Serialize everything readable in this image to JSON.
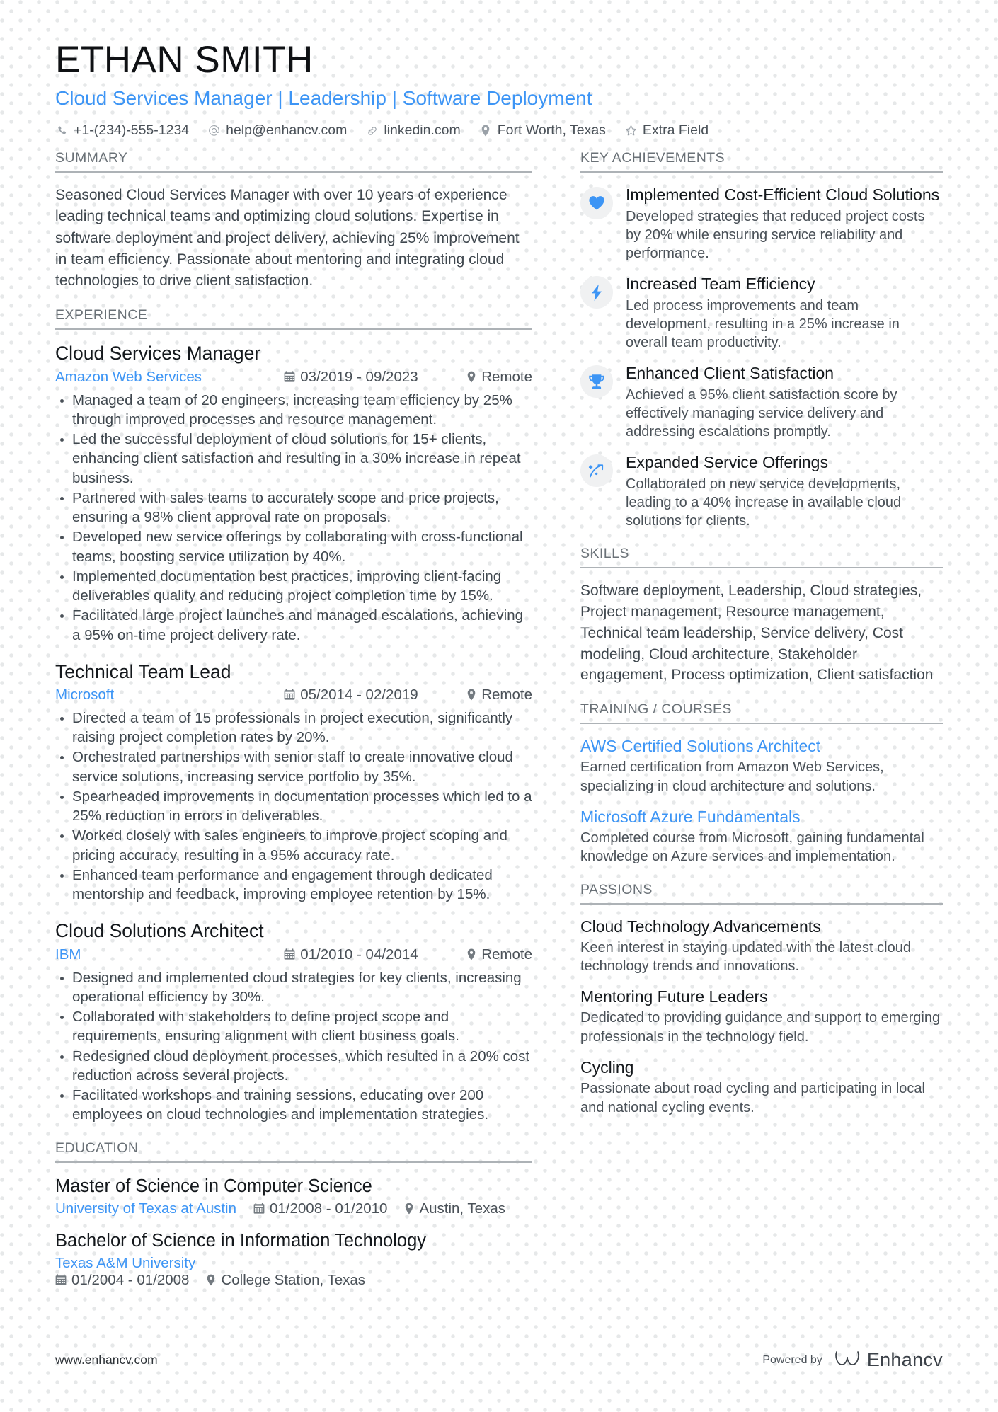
{
  "header": {
    "name": "ETHAN SMITH",
    "headline": "Cloud Services Manager | Leadership | Software Deployment",
    "contacts": [
      {
        "icon": "phone-icon",
        "text": "+1-(234)-555-1234"
      },
      {
        "icon": "at-sign-icon",
        "text": "help@enhancv.com"
      },
      {
        "icon": "link-icon",
        "text": "linkedin.com"
      },
      {
        "icon": "map-pin-icon",
        "text": "Fort Worth, Texas"
      },
      {
        "icon": "star-icon",
        "text": "Extra Field"
      }
    ]
  },
  "colors": {
    "accent_blue": "#3d95f5",
    "heading_gray": "#6a7177",
    "body_text": "#3f474e",
    "rule_gray": "#adb2b6",
    "icon_bubble": "#f0f1f2",
    "dot_pattern": "#e6e8e9"
  },
  "left": {
    "summary": {
      "title": "SUMMARY",
      "text": "Seasoned Cloud Services Manager with over 10 years of experience leading technical teams and optimizing cloud solutions. Expertise in software deployment and project delivery, achieving 25% improvement in team efficiency. Passionate about mentoring and integrating cloud technologies to drive client satisfaction."
    },
    "experience": {
      "title": "EXPERIENCE",
      "jobs": [
        {
          "title": "Cloud Services Manager",
          "company": "Amazon Web Services",
          "dates": "03/2019 - 09/2023",
          "location": "Remote",
          "bullets": [
            "Managed a team of 20 engineers, increasing team efficiency by 25% through improved processes and resource management.",
            "Led the successful deployment of cloud solutions for 15+ clients, enhancing client satisfaction and resulting in a 30% increase in repeat business.",
            "Partnered with sales teams to accurately scope and price projects, ensuring a 98% client approval rate on proposals.",
            "Developed new service offerings by collaborating with cross-functional teams, boosting service utilization by 40%.",
            "Implemented documentation best practices, improving client-facing deliverables quality and reducing project completion time by 15%.",
            "Facilitated large project launches and managed escalations, achieving a 95% on-time project delivery rate."
          ]
        },
        {
          "title": "Technical Team Lead",
          "company": "Microsoft",
          "dates": "05/2014 - 02/2019",
          "location": "Remote",
          "bullets": [
            "Directed a team of 15 professionals in project execution, significantly raising project completion rates by 20%.",
            "Orchestrated partnerships with senior staff to create innovative cloud service solutions, increasing service portfolio by 35%.",
            "Spearheaded improvements in documentation processes which led to a 25% reduction in errors in deliverables.",
            "Worked closely with sales engineers to improve project scoping and pricing accuracy, resulting in a 95% accuracy rate.",
            "Enhanced team performance and engagement through dedicated mentorship and feedback, improving employee retention by 15%."
          ]
        },
        {
          "title": "Cloud Solutions Architect",
          "company": "IBM",
          "dates": "01/2010 - 04/2014",
          "location": "Remote",
          "bullets": [
            "Designed and implemented cloud strategies for key clients, increasing operational efficiency by 30%.",
            "Collaborated with stakeholders to define project scope and requirements, ensuring alignment with client business goals.",
            "Redesigned cloud deployment processes, which resulted in a 20% cost reduction across several projects.",
            "Facilitated workshops and training sessions, educating over 200 employees on cloud technologies and implementation strategies."
          ]
        }
      ]
    },
    "education": {
      "title": "EDUCATION",
      "entries": [
        {
          "degree": "Master of Science in Computer Science",
          "school": "University of Texas at Austin",
          "dates": "01/2008 - 01/2010",
          "location": "Austin, Texas",
          "wrap": false
        },
        {
          "degree": "Bachelor of Science in Information Technology",
          "school": "Texas A&M University",
          "dates": "01/2004 - 01/2008",
          "location": "College Station, Texas",
          "wrap": true
        }
      ]
    }
  },
  "right": {
    "achievements": {
      "title": "KEY ACHIEVEMENTS",
      "items": [
        {
          "icon": "heart-icon",
          "title": "Implemented Cost-Efficient Cloud Solutions",
          "desc": "Developed strategies that reduced project costs by 20% while ensuring service reliability and performance."
        },
        {
          "icon": "lightning-bolt-icon",
          "title": "Increased Team Efficiency",
          "desc": "Led process improvements and team development, resulting in a 25% increase in overall team productivity."
        },
        {
          "icon": "trophy-icon",
          "title": "Enhanced Client Satisfaction",
          "desc": "Achieved a 95% client satisfaction score by effectively managing service delivery and addressing escalations promptly."
        },
        {
          "icon": "growth-arrow-icon",
          "title": "Expanded Service Offerings",
          "desc": "Collaborated on new service developments, leading to a 40% increase in available cloud solutions for clients."
        }
      ]
    },
    "skills": {
      "title": "SKILLS",
      "text": "Software deployment, Leadership, Cloud strategies, Project management, Resource management, Technical team leadership, Service delivery, Cost modeling, Cloud architecture, Stakeholder engagement, Process optimization, Client satisfaction"
    },
    "training": {
      "title": "TRAINING / COURSES",
      "items": [
        {
          "title": "AWS Certified Solutions Architect",
          "desc": "Earned certification from Amazon Web Services, specializing in cloud architecture and solutions."
        },
        {
          "title": "Microsoft Azure Fundamentals",
          "desc": "Completed course from Microsoft, gaining fundamental knowledge on Azure services and implementation."
        }
      ]
    },
    "passions": {
      "title": "PASSIONS",
      "items": [
        {
          "title": "Cloud Technology Advancements",
          "desc": "Keen interest in staying updated with the latest cloud technology trends and innovations."
        },
        {
          "title": "Mentoring Future Leaders",
          "desc": "Dedicated to providing guidance and support to emerging professionals in the technology field."
        },
        {
          "title": "Cycling",
          "desc": "Passionate about road cycling and participating in local and national cycling events."
        }
      ]
    }
  },
  "footer": {
    "url": "www.enhancv.com",
    "powered_by": "Powered by",
    "brand": "Enhancv"
  }
}
